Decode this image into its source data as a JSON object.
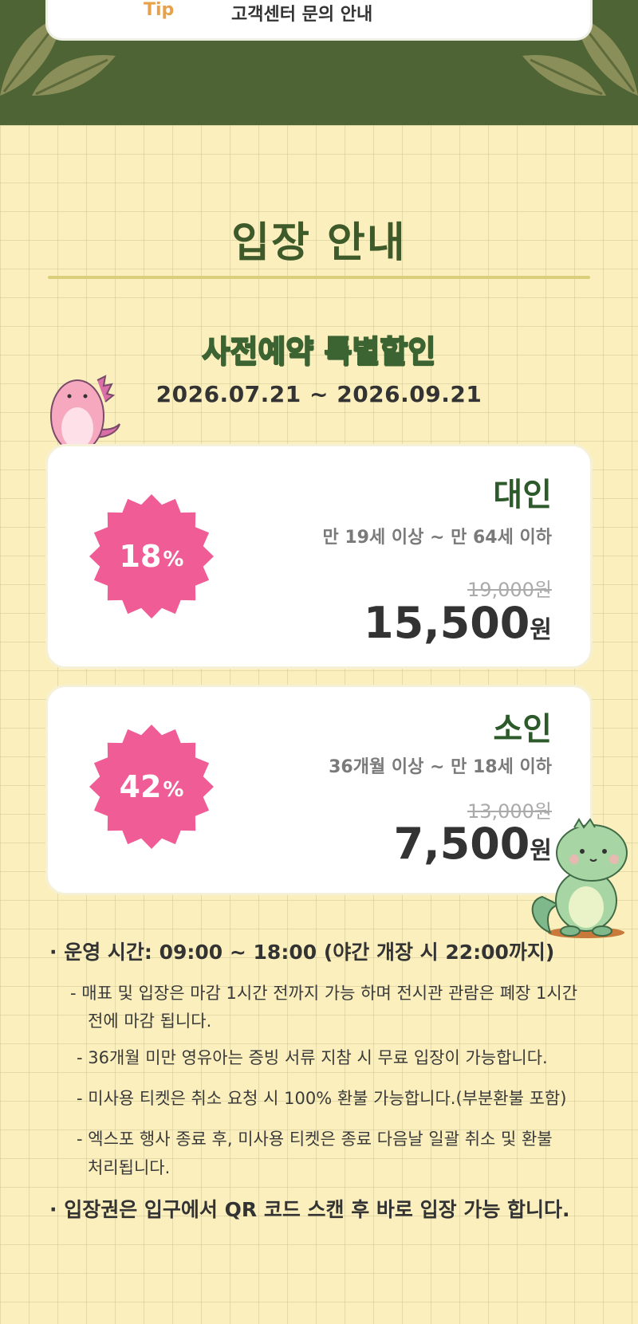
{
  "top": {
    "card_text": "고객센터 문의 안내",
    "accent": "Tip"
  },
  "section": {
    "title": "입장 안내"
  },
  "promo": {
    "title": "사전예약 특별할인",
    "dates": "2026.07.21 ~ 2026.09.21"
  },
  "tickets": {
    "adult": {
      "discount_value": "18",
      "discount_unit": "%",
      "label": "대인",
      "age": "만 19세 이상 ~ 만 64세 이하",
      "original_price": "19,000원",
      "price_value": "15,500",
      "price_unit": "원"
    },
    "child": {
      "discount_value": "42",
      "discount_unit": "%",
      "label": "소인",
      "age": "36개월 이상 ~ 만 18세 이하",
      "original_price": "13,000원",
      "price_value": "7,500",
      "price_unit": "원"
    }
  },
  "info": {
    "hours": "· 운영 시간: 09:00 ~ 18:00 (야간 개장 시 22:00까지)",
    "note1_line1": "- 매표 및 입장은 마감 1시간 전까지 가능 하며 전시관 관람은 폐장 1시간",
    "note1_line2": "전에 마감 됩니다.",
    "note2": "- 36개월 미만 영유아는 증빙 서류 지참 시 무료 입장이 가능합니다.",
    "note3": "- 미사용 티켓은 취소 요청 시 100% 환불 가능합니다.(부분환불 포함)",
    "note4_line1": "- 엑스포 행사 종료 후, 미사용 티켓은 종료 다음날 일괄 취소 및 환불",
    "note4_line2": "처리됩니다.",
    "qr": "· 입장권은 입구에서 QR 코드 스캔 후 바로 입장 가능 합니다."
  },
  "colors": {
    "header_green": "#4f6435",
    "background": "#fbf0bd",
    "badge_pink": "#ef5c96",
    "title_green": "#3f5a2a"
  }
}
